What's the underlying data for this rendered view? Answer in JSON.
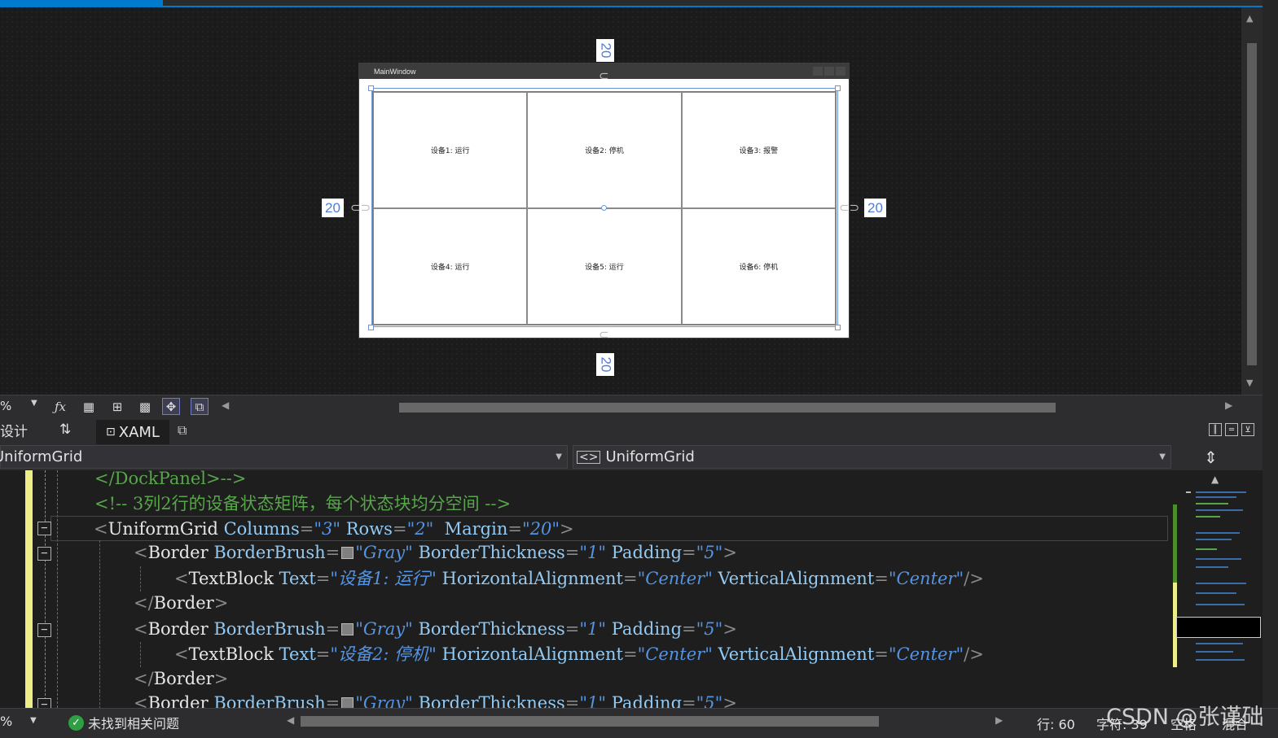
{
  "designer": {
    "window_title": "MainWindow",
    "cells": [
      "设备1: 运行",
      "设备2: 停机",
      "设备3: 报警",
      "设备4: 运行",
      "设备5: 运行",
      "设备6: 停机"
    ],
    "margin_top": "20",
    "margin_bottom": "20",
    "margin_left": "20",
    "margin_right": "20",
    "accent_color": "#6d95d8"
  },
  "toolbar": {
    "zoom": "%",
    "icons": [
      "fx-icon",
      "grid-icon",
      "snap-grid-icon",
      "transparency-icon",
      "snap-lines-icon",
      "layout-rounding-icon"
    ]
  },
  "tabs": {
    "design": "设计",
    "xaml": "XAML"
  },
  "nav": {
    "left_combo": "UniformGrid",
    "right_combo": "UniformGrid"
  },
  "code": {
    "line1_close": "</DockPanel>-->",
    "line2_comment": "<!-- 3列2行的设备状态矩阵，每个状态块均分空间 -->",
    "ug_tag": "UniformGrid",
    "ug_columns_attr": "Columns",
    "ug_columns_val": "\"3\"",
    "ug_rows_attr": "Rows",
    "ug_rows_val": "\"2\"",
    "ug_margin_attr": "Margin",
    "ug_margin_val": "\"20\"",
    "border_tag": "Border",
    "border_brush_attr": "BorderBrush",
    "border_brush_val": "\"Gray\"",
    "border_thickness_attr": "BorderThickness",
    "border_thickness_val": "\"1\"",
    "padding_attr": "Padding",
    "padding_val": "\"5\"",
    "textblock_tag": "TextBlock",
    "text_attr": "Text",
    "text_val_1": "\"设备1: 运行\"",
    "text_val_2": "\"设备2: 停机\"",
    "halign_attr": "HorizontalAlignment",
    "halign_val": "\"Center\"",
    "valign_attr": "VerticalAlignment",
    "valign_val": "\"Center\"",
    "border_close": "</Border>"
  },
  "status": {
    "zoom": "%",
    "issues": "未找到相关问题",
    "line": "行: 60",
    "char": "字符: 39",
    "spaces": "空格",
    "crlf": "混合"
  },
  "watermark": "CSDN @张谨础"
}
